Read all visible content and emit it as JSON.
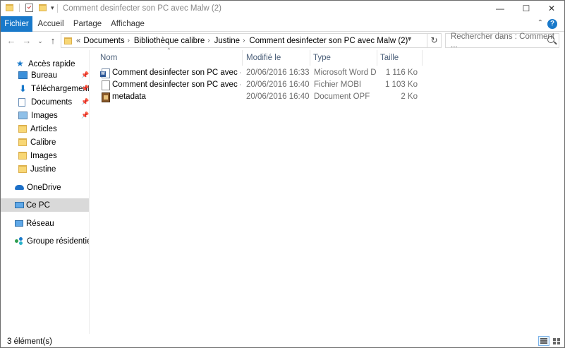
{
  "window": {
    "title": "Comment desinfecter son PC avec Malw (2)",
    "minimize": "—",
    "maximize": "☐",
    "close": "✕"
  },
  "ribbon": {
    "tabs": [
      "Fichier",
      "Accueil",
      "Partage",
      "Affichage"
    ],
    "help": "?",
    "collapse": "⌃"
  },
  "nav": {
    "back": "←",
    "forward": "→",
    "recent": "⌄",
    "up": "↑",
    "breadcrumb_prefix": "«",
    "breadcrumb": [
      "Documents",
      "Bibliothèque calibre",
      "Justine",
      "Comment desinfecter son PC avec Malw (2)"
    ],
    "separator": "›",
    "refresh": "↻",
    "search_placeholder": "Rechercher dans : Comment ..."
  },
  "sidebar": {
    "quick_access": "Accès rapide",
    "items": [
      {
        "label": "Bureau",
        "icon": "desktop-icon",
        "pinned": true
      },
      {
        "label": "Téléchargements",
        "icon": "download-icon",
        "pinned": true
      },
      {
        "label": "Documents",
        "icon": "documents-icon",
        "pinned": true
      },
      {
        "label": "Images",
        "icon": "pictures-icon",
        "pinned": true
      },
      {
        "label": "Articles",
        "icon": "folder-icon",
        "pinned": false
      },
      {
        "label": "Calibre",
        "icon": "folder-icon",
        "pinned": false
      },
      {
        "label": "Images",
        "icon": "folder-icon",
        "pinned": false
      },
      {
        "label": "Justine",
        "icon": "folder-icon",
        "pinned": false
      }
    ],
    "onedrive": "OneDrive",
    "this_pc": "Ce PC",
    "network": "Réseau",
    "homegroup": "Groupe résidentiel",
    "pin_glyph": "📌"
  },
  "columns": {
    "name": "Nom",
    "modified": "Modifié le",
    "type": "Type",
    "size": "Taille"
  },
  "files": [
    {
      "name": "Comment desinfecter son PC avec - Justi...",
      "modified": "20/06/2016 16:33",
      "type": "Microsoft Word D...",
      "size": "1 116 Ko",
      "icon": "word-document-icon"
    },
    {
      "name": "Comment desinfecter son PC avec - Justi...",
      "modified": "20/06/2016 16:40",
      "type": "Fichier MOBI",
      "size": "1 103 Ko",
      "icon": "mobi-file-icon"
    },
    {
      "name": "metadata",
      "modified": "20/06/2016 16:40",
      "type": "Document OPF",
      "size": "2 Ko",
      "icon": "opf-file-icon"
    }
  ],
  "status": {
    "count": "3 élément(s)"
  },
  "colors": {
    "accent": "#1979ca",
    "folder": "#f8d775",
    "selected": "#d9d9d9"
  }
}
